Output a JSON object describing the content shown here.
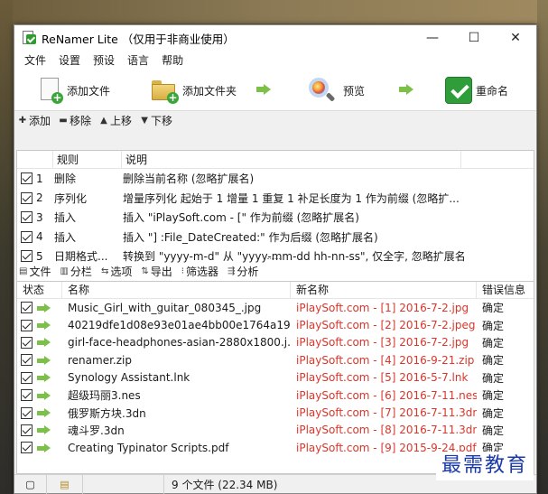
{
  "window": {
    "title": "ReNamer Lite （仅用于非商业使用）",
    "controls": {
      "minimize": "—",
      "maximize": "☐",
      "close": "✕"
    }
  },
  "menu": [
    "文件",
    "设置",
    "预设",
    "语言",
    "帮助"
  ],
  "toolbar": {
    "add_files": "添加文件",
    "add_folders": "添加文件夹",
    "preview": "预览",
    "rename": "重命名"
  },
  "rule_toolbar": {
    "add": "添加",
    "remove": "移除",
    "up": "上移",
    "down": "下移"
  },
  "rules": {
    "columns": [
      "规则",
      "说明"
    ],
    "rows": [
      {
        "num": "1",
        "rule": "删除",
        "desc": "删除当前名称 (忽略扩展名)"
      },
      {
        "num": "2",
        "rule": "序列化",
        "desc": "增量序列化 起始于 1 增量 1 重复 1 补足长度为 1 作为前缀 (忽略扩..."
      },
      {
        "num": "3",
        "rule": "插入",
        "desc": "插入 \"iPlaySoft.com - [\" 作为前缀 (忽略扩展名)"
      },
      {
        "num": "4",
        "rule": "插入",
        "desc": "插入 \"] :File_DateCreated:\" 作为后缀 (忽略扩展名)"
      },
      {
        "num": "5",
        "rule": "日期格式...",
        "desc": "转换到 \"yyyy-m-d\" 从 \"yyyy-mm-dd hh-nn-ss\", 仅全字, 忽略扩展名"
      }
    ]
  },
  "file_toolbar": {
    "files": "文件",
    "columns": "分栏",
    "options": "选项",
    "export": "导出",
    "filter": "筛选器",
    "analyze": "分析"
  },
  "files": {
    "columns": [
      "状态",
      "名称",
      "新名称",
      "错误信息"
    ],
    "rows": [
      {
        "name": "Music_Girl_with_guitar_080345_.jpg",
        "new": "iPlaySoft.com - [1] 2016-7-2.jpg",
        "err": "确定"
      },
      {
        "name": "40219dfe1d08e93e01ae4bb00e1764a19...",
        "new": "iPlaySoft.com - [2] 2016-7-2.jpeg",
        "err": "确定"
      },
      {
        "name": "girl-face-headphones-asian-2880x1800.j...",
        "new": "iPlaySoft.com - [3] 2016-7-2.jpg",
        "err": "确定"
      },
      {
        "name": "renamer.zip",
        "new": "iPlaySoft.com - [4] 2016-9-21.zip",
        "err": "确定"
      },
      {
        "name": "Synology Assistant.lnk",
        "new": "iPlaySoft.com - [5] 2016-5-7.lnk",
        "err": "确定"
      },
      {
        "name": "超级玛丽3.nes",
        "new": "iPlaySoft.com - [6] 2016-7-11.nes",
        "err": "确定"
      },
      {
        "name": "俄罗斯方块.3dn",
        "new": "iPlaySoft.com - [7] 2016-7-11.3dn",
        "err": "确定"
      },
      {
        "name": "魂斗罗.3dn",
        "new": "iPlaySoft.com - [8] 2016-7-11.3dn",
        "err": "确定"
      },
      {
        "name": "Creating Typinator Scripts.pdf",
        "new": "iPlaySoft.com - [9] 2015-9-24.pdf",
        "err": "确定"
      }
    ]
  },
  "status": {
    "count": "9 个文件 (22.34 MB)"
  },
  "watermark": "最需教育"
}
